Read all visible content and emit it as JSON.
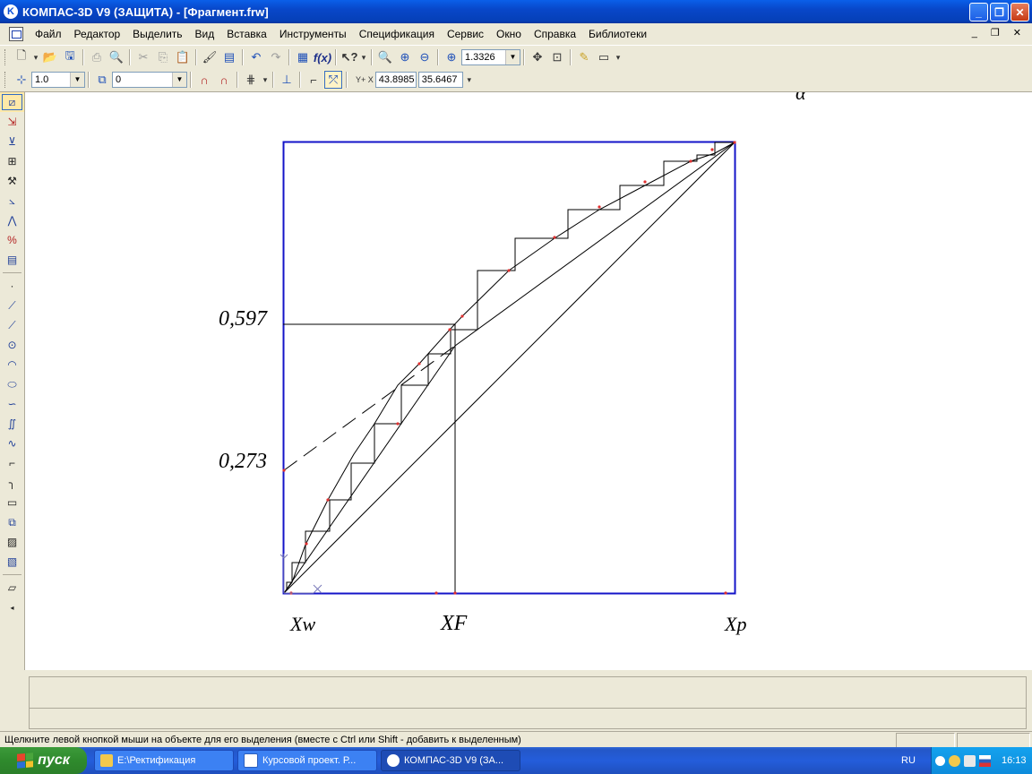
{
  "window": {
    "title": "КОМПАС-3D V9 (ЗАЩИТА) - [Фрагмент.frw]",
    "app_icon_glyph": "K",
    "buttons": {
      "minimize": "_",
      "maximize": "❐",
      "close": "✕"
    }
  },
  "menu": {
    "items": [
      "Файл",
      "Редактор",
      "Выделить",
      "Вид",
      "Вставка",
      "Инструменты",
      "Спецификация",
      "Сервис",
      "Окно",
      "Справка",
      "Библиотеки"
    ],
    "mdi_controls": "_ ❐ ✕"
  },
  "toolbar_main": {
    "zoom_value": "1.3326"
  },
  "toolbar_current": {
    "scale_value": "1.0",
    "layer_value": "0",
    "coord_label": "Y+ X",
    "x_value": "43.8985",
    "y_value": "35.6467"
  },
  "drawing": {
    "label_0597": "0,597",
    "label_0273": "0,273",
    "label_xw": "Xw",
    "label_xf": "XF",
    "label_xp": "Xp",
    "corner_glyph": "α",
    "colors": {
      "frame": "#1414c8",
      "lines": "#000000",
      "points": "#e03030"
    }
  },
  "status": {
    "hint": "Щелкните левой кнопкой мыши на объекте для его выделения (вместе с Ctrl или Shift - добавить к выделенным)"
  },
  "taskbar": {
    "start_label": "пуск",
    "tasks": [
      {
        "label": "E:\\Ректификация"
      },
      {
        "label": "Курсовой проект. Р..."
      },
      {
        "label": "КОМПАС-3D V9 (ЗА..."
      }
    ],
    "language": "RU",
    "clock": "16:13"
  }
}
